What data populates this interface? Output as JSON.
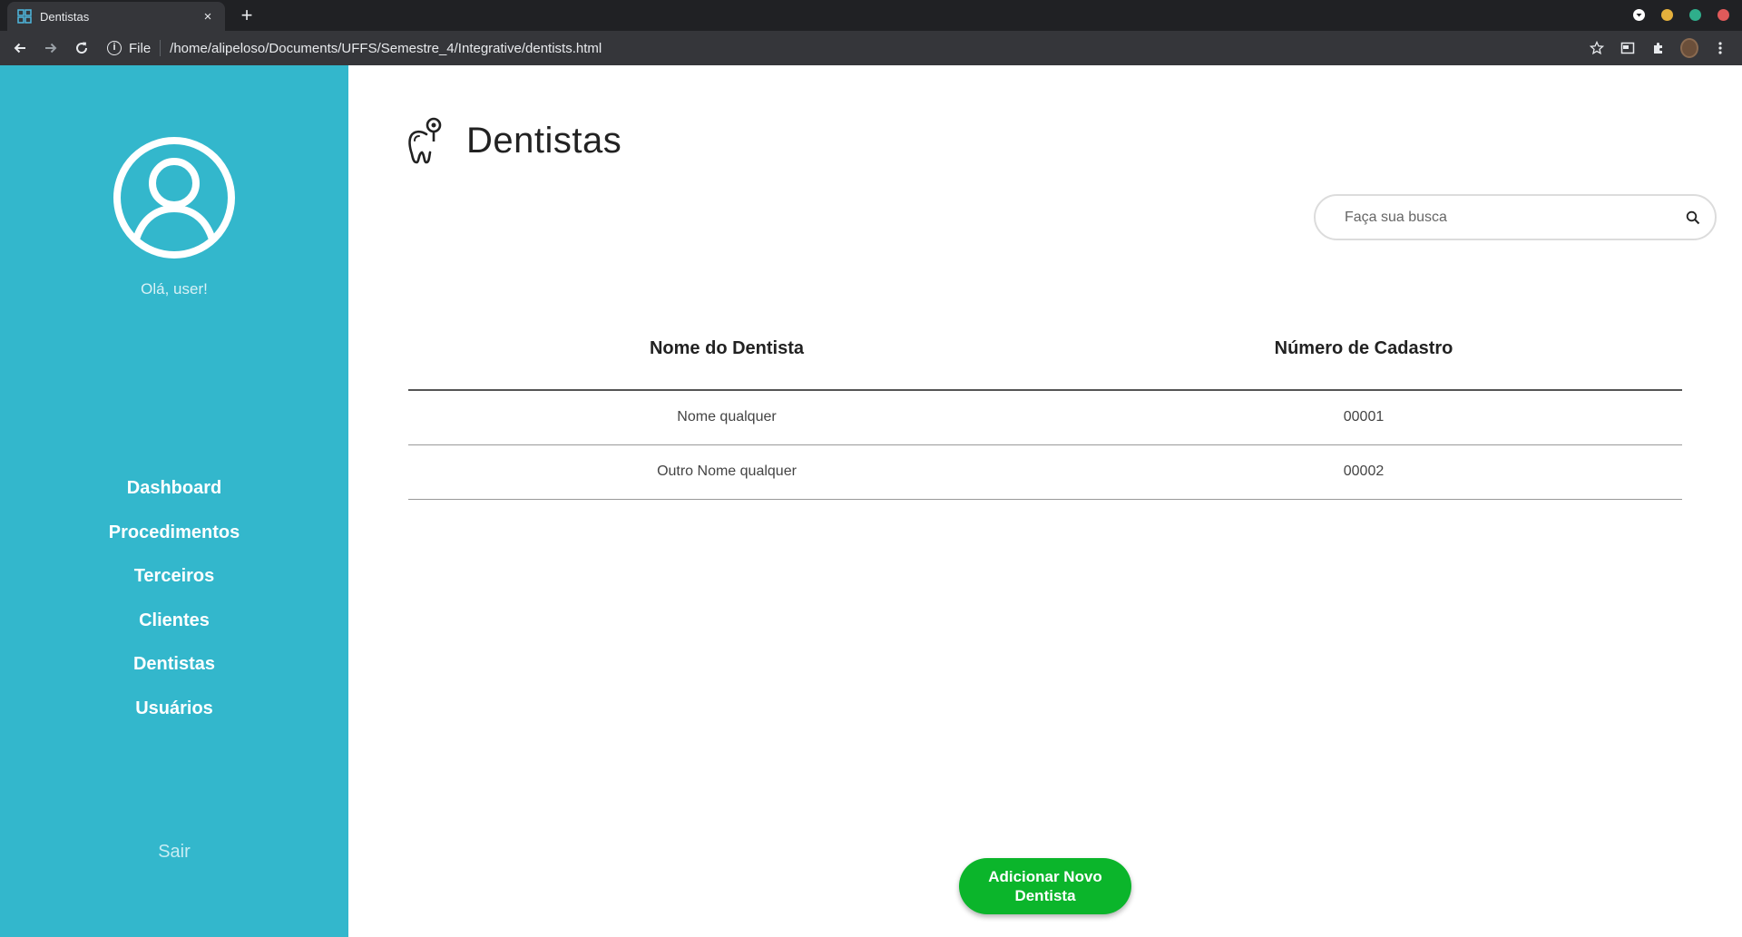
{
  "browser": {
    "tab_title": "Dentistas",
    "tab_close": "×",
    "new_tab": "+",
    "scheme_label": "File",
    "url": "/home/alipeloso/Documents/UFFS/Semestre_4/Integrative/dentists.html",
    "info_glyph": "i",
    "window_controls": [
      {
        "name": "dropdown",
        "color": "#ffffff"
      },
      {
        "name": "minimize",
        "color": "#e5b03c"
      },
      {
        "name": "maximize",
        "color": "#2fae8b"
      },
      {
        "name": "close",
        "color": "#e05a5a"
      }
    ]
  },
  "sidebar": {
    "greeting": "Olá, user!",
    "items": [
      {
        "label": "Dashboard"
      },
      {
        "label": "Procedimentos"
      },
      {
        "label": "Terceiros"
      },
      {
        "label": "Clientes"
      },
      {
        "label": "Dentistas"
      },
      {
        "label": "Usuários"
      }
    ],
    "logout": "Sair",
    "background": "#33b7cc"
  },
  "main": {
    "title": "Dentistas",
    "search": {
      "placeholder": "Faça sua busca"
    },
    "table": {
      "headers": [
        "Nome do Dentista",
        "Número de Cadastro"
      ],
      "rows": [
        [
          "Nome qualquer",
          "00001"
        ],
        [
          "Outro Nome qualquer",
          "00002"
        ]
      ]
    },
    "add_button": "Adicionar Novo Dentista",
    "add_button_color": "#0bb52b"
  }
}
